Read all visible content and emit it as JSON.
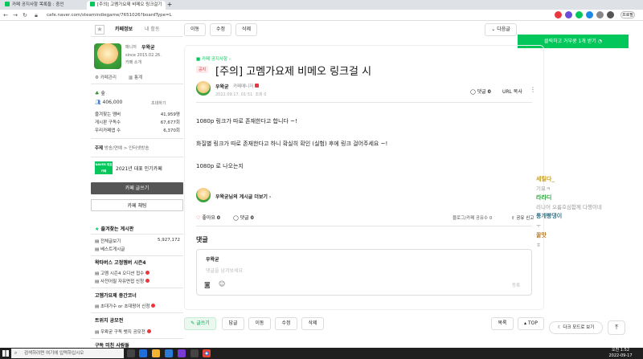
{
  "browser": {
    "tabs": [
      {
        "label": "카페 공지사항 목록들 : 중인",
        "active": false
      },
      {
        "label": "[주의] 고멤가요제 비메오 링크걸기",
        "active": true
      }
    ],
    "new_tab": "+",
    "url": "cafe.naver.com/steamindiegame/7651026?boardType=L",
    "profile_label": "프로필"
  },
  "ad": {
    "button": "클릭하고 거부쿵 1개 받기"
  },
  "sidebar": {
    "tabs": [
      "카페정보",
      "내 활동"
    ],
    "manager_label": "매니저",
    "manager_name": "우왁굳",
    "since": "since 2015.02.26.",
    "intro": "카페 소개",
    "manage": "카페관리",
    "stats": "통계",
    "grade": "숲",
    "members": "406,000",
    "invite": "초대하기",
    "stats_rows": [
      {
        "label": "즐겨찾는 멤버",
        "value": "41,959명"
      },
      {
        "label": "게시판 구독수",
        "value": "67,677회"
      },
      {
        "label": "우리카페앱 수",
        "value": "6,370회"
      }
    ],
    "theme_label": "주제",
    "theme_value": "방송/연예 > 인터넷방송",
    "award": "2021년 대표 인기카페",
    "naver_badge": "NAVER 대표카페",
    "write_button": "카페 글쓰기",
    "chat_button": "카페 채팅",
    "fav_header": "즐겨찾는 게시판",
    "boards": [
      {
        "label": "전체글보기",
        "count": "5,927,172"
      },
      {
        "label": "베스트게시글",
        "count": ""
      }
    ],
    "section1": "왁타버스 고정멤버 시즌4",
    "section1_items": [
      "고멤 시즌4 오디션 접수",
      "사전어필 자유면접 신청"
    ],
    "section2": "고멤가요제 중간코너",
    "section2_items": [
      "초대가수 or 초대왕어 신청"
    ],
    "section3": "트위치 공모전",
    "section3_items": [
      "우왁굳 구독 뱃지 공모전"
    ],
    "section4": "구독 미친 사람들"
  },
  "toolbar": {
    "move": "이동",
    "edit": "수정",
    "delete": "삭제",
    "next": "다음글"
  },
  "post": {
    "board": "카페 공지사항",
    "badge": "공지",
    "title": "[주의] 고멤가요제 비메오 링크걸 시",
    "author": "우왁굳",
    "author_role": "카페매니저",
    "date": "2022.09.17. 01:51",
    "views": "조회 0",
    "comments_label": "댓글",
    "comments_count": "0",
    "url_copy": "URL 복사",
    "body": [
      "1080p 링크가 따로 존재한다고 합니다 ~!",
      "화질별 링크가 따로 존재한다고 하니 확실히 확인 (실험) 후에 링크 걸어주세요 ~!",
      "1080p 로 나오는지"
    ],
    "author_more": "우왁굳님의 게시글 더보기",
    "like_label": "좋아요",
    "like_count": "0",
    "comment_label": "댓글",
    "comment_count": "0",
    "share_text": "블로그/카페 공유수",
    "share_count": "0",
    "share_label": "공유",
    "report": "신고"
  },
  "comments": {
    "header": "댓글",
    "writer": "우왁굳",
    "placeholder": "댓글을 남겨보세요",
    "submit": "등록"
  },
  "bottom_toolbar": {
    "write": "글쓰기",
    "reply": "답글",
    "move": "이동",
    "edit": "수정",
    "delete": "삭제",
    "list": "목록",
    "top": "TOP",
    "dark": "다크 모드로 보기"
  },
  "chat": [
    {
      "name": "세릴다_",
      "msg": "기묘ㅋ",
      "color": "#c8a026"
    },
    {
      "name": "라라디",
      "msg": "리니어 오름호심함께 다행이네",
      "color": "#2aa33a"
    },
    {
      "name": "통개빵댕이",
      "msg": "ㅜ",
      "color": "#3c7a8e"
    },
    {
      "name": "꿀맛",
      "msg": "ㅎ",
      "color": "#b5782a"
    }
  ],
  "taskbar": {
    "search": "검색하려면 여기에 입력하십시오",
    "time": "오전 1:52",
    "date": "2022-09-17"
  }
}
